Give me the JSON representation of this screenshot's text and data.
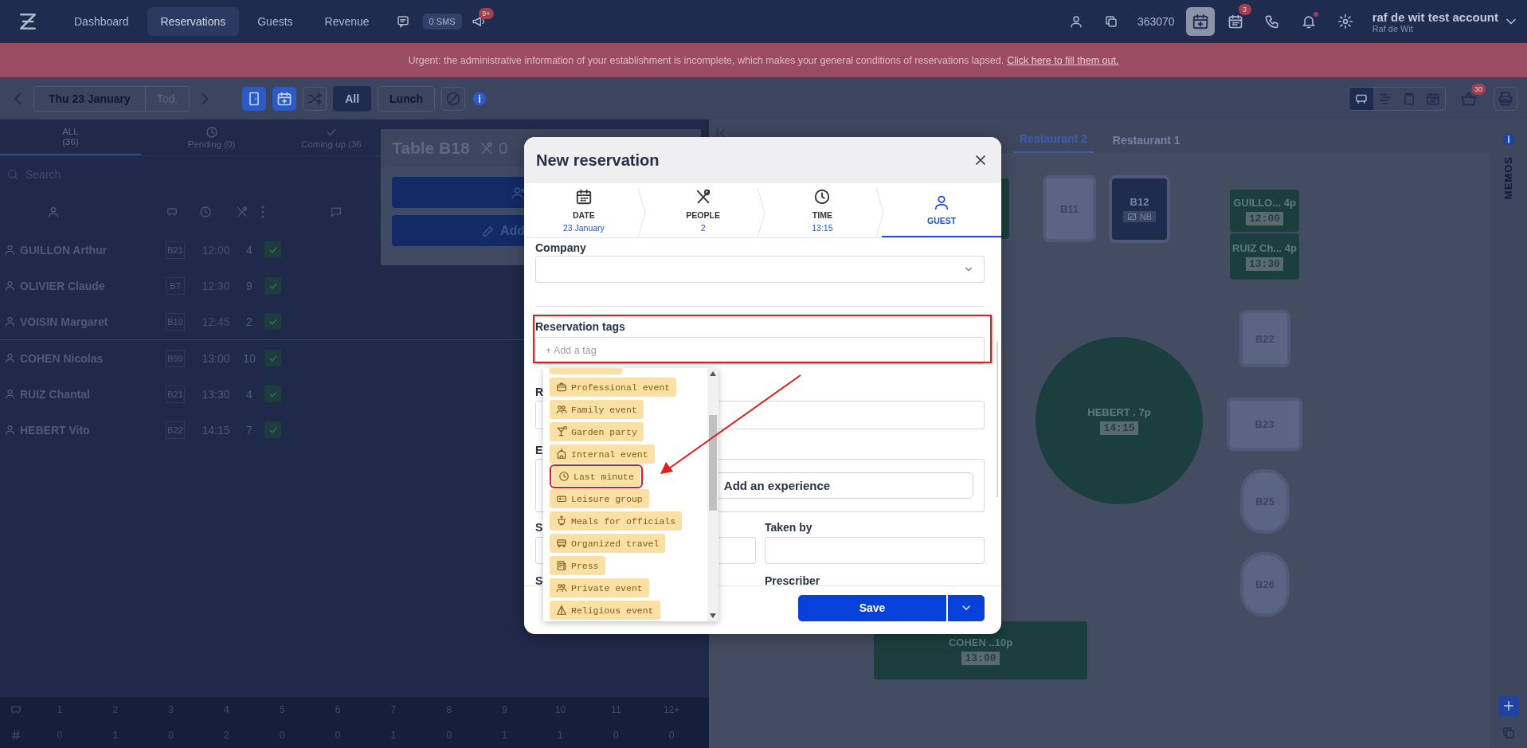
{
  "top_nav": {
    "items": [
      {
        "label": "Dashboard",
        "selected": false
      },
      {
        "label": "Reservations",
        "selected": true
      },
      {
        "label": "Guests",
        "selected": false
      },
      {
        "label": "Revenue",
        "selected": false
      }
    ],
    "sms": "0 SMS",
    "announcements_badge": "9+",
    "account_id": "363070",
    "calendar_badge": "3",
    "account_name": "raf de wit test account",
    "user_name": "Raf de Wit"
  },
  "banner": {
    "text": "Urgent: the administrative information of your establishment is incomplete, which makes your general conditions of reservations lapsed.",
    "link": "Click here to fill them out."
  },
  "toolbar": {
    "date": "Thu 23 January",
    "today": "Tod.",
    "filters": [
      {
        "label": "All",
        "selected": true
      },
      {
        "label": "Lunch",
        "selected": false
      }
    ],
    "views": [
      {
        "selected": true
      },
      {
        "selected": false
      },
      {
        "selected": false
      },
      {
        "selected": false
      }
    ],
    "basket_badge": "30"
  },
  "list_panel": {
    "tabs": [
      {
        "label": "ALL",
        "count": "(36)",
        "selected": true
      },
      {
        "label": "Pending (0)",
        "selected": false
      },
      {
        "label": "Coming up (36",
        "selected": false
      }
    ],
    "search": {
      "placeholder": "Search"
    },
    "rows": [
      {
        "name": "GUILLON Arthur",
        "table": "B21",
        "time": "12:00",
        "guests": "4",
        "past": true,
        "checked": true
      },
      {
        "name": "OLIVIER Claude",
        "table": "B7",
        "time": "12:30",
        "guests": "9",
        "past": true,
        "checked": true
      },
      {
        "name": "VOISIN Margaret",
        "table": "B10",
        "time": "12:45",
        "guests": "2",
        "past": true,
        "checked": true
      },
      {
        "name": "COHEN Nicolas",
        "table": "B99",
        "time": "13:00",
        "guests": "10",
        "past": false,
        "checked": true
      },
      {
        "name": "RUIZ Chantal",
        "table": "B21",
        "time": "13:30",
        "guests": "4",
        "past": false,
        "checked": true
      },
      {
        "name": "HEBERT Vito",
        "table": "B22",
        "time": "14:15",
        "guests": "7",
        "past": false,
        "checked": true
      }
    ],
    "summary": {
      "sizes": [
        "1",
        "2",
        "3",
        "4",
        "5",
        "6",
        "7",
        "8",
        "9",
        "10",
        "11",
        "12+"
      ],
      "counts": [
        "0",
        "1",
        "0",
        "2",
        "0",
        "0",
        "1",
        "0",
        "1",
        "1",
        "0",
        "0"
      ]
    }
  },
  "table_popup": {
    "title": "Table B18",
    "covers": "0",
    "add_button": "Add"
  },
  "floor": {
    "tabs": [
      {
        "label": "Restaurant 2",
        "selected": true
      },
      {
        "label": "Restaurant 1",
        "selected": false
      }
    ],
    "tables": [
      {
        "kind": "rect",
        "booked": true,
        "blocked": false
      },
      {
        "kind": "rect",
        "booked": false,
        "blocked": false,
        "label": "B11"
      },
      {
        "kind": "rect",
        "booked": false,
        "blocked": true,
        "label": "B12",
        "badge": "NB"
      },
      {
        "kind": "rect",
        "booked": true,
        "blocked": false,
        "label": "GUILLO... 4p",
        "time": "12:00"
      },
      {
        "kind": "rect",
        "booked": true,
        "blocked": false,
        "label": "RUIZ Ch... 4p",
        "time": "13:30"
      },
      {
        "kind": "rect",
        "booked": false,
        "blocked": false,
        "label": "B22"
      },
      {
        "kind": "round",
        "booked": true,
        "blocked": false,
        "label": "HEBERT . 7p",
        "time": "14:15"
      },
      {
        "kind": "rect",
        "booked": false,
        "blocked": false,
        "label": "B23"
      },
      {
        "kind": "oval",
        "booked": false,
        "blocked": false,
        "label": "B25"
      },
      {
        "kind": "oval",
        "booked": false,
        "blocked": false,
        "label": "B26"
      },
      {
        "kind": "rect",
        "booked": true,
        "blocked": false,
        "label": "COHEN ..10p",
        "time": "13:00"
      }
    ]
  },
  "sidebar": {
    "memos": "MEMOS"
  },
  "modal": {
    "title": "New reservation",
    "steps": [
      {
        "label": "DATE",
        "value": "23 January",
        "selected": false
      },
      {
        "label": "PEOPLE",
        "value": "2",
        "selected": false
      },
      {
        "label": "TIME",
        "value": "13:15",
        "selected": false
      },
      {
        "label": "GUEST",
        "selected": true
      }
    ],
    "company": {
      "label": "Company"
    },
    "reservation_tags": {
      "label": "Reservation tags",
      "placeholder": "+ Add a tag",
      "highlighted": true
    },
    "field_r": {
      "label": "R"
    },
    "field_e": {
      "label": "E",
      "button": "Add an experience"
    },
    "field_s1": {
      "label": "S"
    },
    "taken_by": {
      "label": "Taken by"
    },
    "field_s2": {
      "label": "S"
    },
    "prescriber": {
      "label": "Prescriber"
    },
    "save": "Save",
    "tag_options": [
      {
        "label": "Professional event",
        "highlighted": false
      },
      {
        "label": "Family event",
        "highlighted": false
      },
      {
        "label": "Garden party",
        "highlighted": false
      },
      {
        "label": "Internal event",
        "highlighted": false
      },
      {
        "label": "Last minute",
        "highlighted": true
      },
      {
        "label": "Leisure group",
        "highlighted": false
      },
      {
        "label": "Meals for officials",
        "highlighted": false
      },
      {
        "label": "Organized travel",
        "highlighted": false
      },
      {
        "label": "Press",
        "highlighted": false
      },
      {
        "label": "Private event",
        "highlighted": false
      },
      {
        "label": "Religious event",
        "highlighted": false
      }
    ]
  }
}
